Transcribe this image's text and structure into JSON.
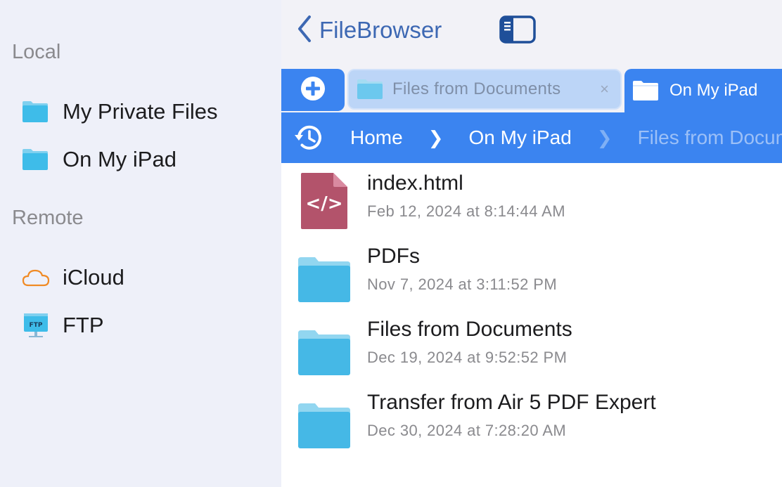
{
  "sidebar": {
    "sections": [
      {
        "title": "Local",
        "items": [
          {
            "label": "My Private Files",
            "icon": "folder-icon"
          },
          {
            "label": "On My iPad",
            "icon": "folder-icon"
          }
        ]
      },
      {
        "title": "Remote",
        "items": [
          {
            "label": "iCloud",
            "icon": "cloud-icon"
          },
          {
            "label": "FTP",
            "icon": "ftp-icon",
            "icon_text": "FTP"
          }
        ]
      }
    ]
  },
  "header": {
    "back_label": "FileBrowser"
  },
  "tabs": [
    {
      "label": "Files from Documents",
      "active": false,
      "close_glyph": "×"
    },
    {
      "label": "On My iPad",
      "active": true
    }
  ],
  "breadcrumb": {
    "items": [
      "Home",
      "On My iPad",
      "Files from Documents"
    ],
    "separator": "❯"
  },
  "files": [
    {
      "name": "index.html",
      "date": "Feb 12, 2024 at 8:14:44 AM",
      "icon": "html-file-icon",
      "icon_text": "</>"
    },
    {
      "name": "PDFs",
      "date": "Nov 7, 2024 at 3:11:52 PM",
      "icon": "folder-icon"
    },
    {
      "name": "Files from Documents",
      "date": "Dec 19, 2024 at 9:52:52 PM",
      "icon": "folder-icon"
    },
    {
      "name": "Transfer from Air 5 PDF Expert",
      "date": "Dec 30, 2024 at 7:28:20 AM",
      "icon": "folder-icon"
    }
  ],
  "colors": {
    "accent": "#3b84f0",
    "back_text": "#3d68b3",
    "sidebar_bg": "#eef0f9",
    "cloud_orange": "#f08a24",
    "html_icon": "#b3536b"
  }
}
